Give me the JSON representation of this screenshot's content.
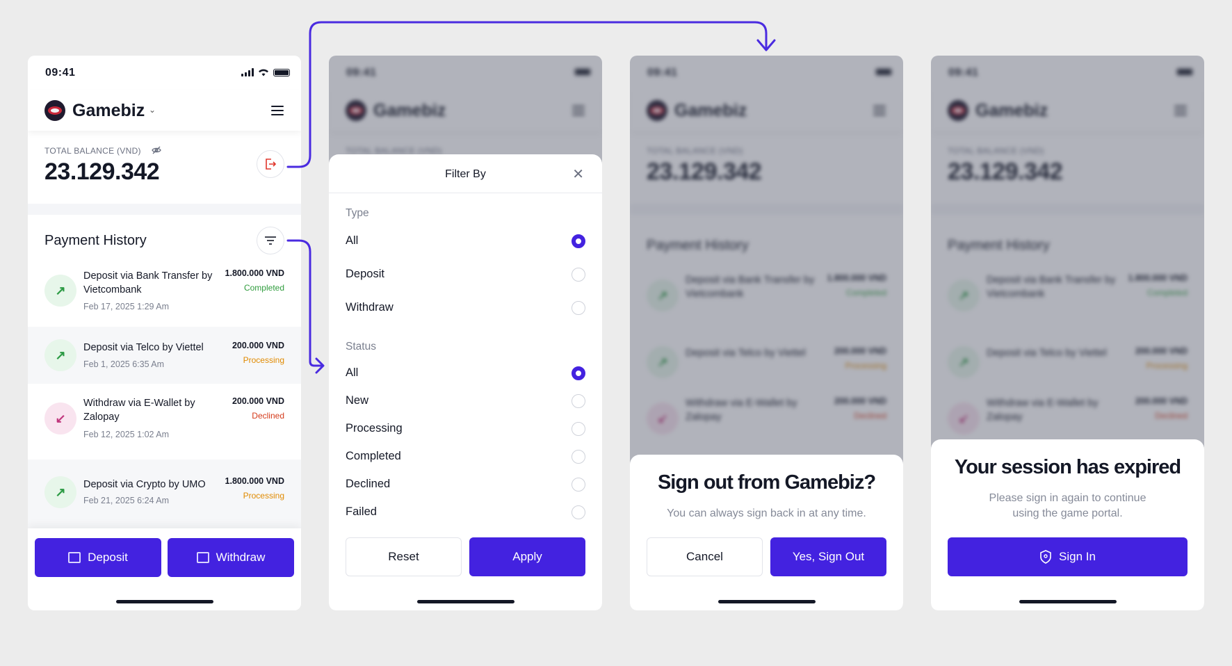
{
  "status_bar": {
    "time": "09:41"
  },
  "app": {
    "brand": "Gamebiz"
  },
  "balance": {
    "label": "TOTAL BALANCE (VND)",
    "value": "23.129.342"
  },
  "history": {
    "title": "Payment History",
    "transactions": [
      {
        "title": "Deposit via Bank Transfer by Vietcombank",
        "date": "Feb 17, 2025 1:29 Am",
        "amount": "1.800.000 VND",
        "status": "Completed",
        "direction": "in"
      },
      {
        "title": "Deposit via Telco by Viettel",
        "date": "Feb 1, 2025 6:35 Am",
        "amount": "200.000 VND",
        "status": "Processing",
        "direction": "in"
      },
      {
        "title": "Withdraw via E-Wallet by Zalopay",
        "date": "Feb 12, 2025 1:02 Am",
        "amount": "200.000 VND",
        "status": "Declined",
        "direction": "out"
      },
      {
        "title": "Deposit via Crypto by UMO",
        "date": "Feb 21, 2025 6:24 Am",
        "amount": "1.800.000 VND",
        "status": "Processing",
        "direction": "in"
      }
    ]
  },
  "actions": {
    "deposit": "Deposit",
    "withdraw": "Withdraw"
  },
  "filter_sheet": {
    "title": "Filter By",
    "type_label": "Type",
    "type_options": [
      "All",
      "Deposit",
      "Withdraw"
    ],
    "type_selected": "All",
    "status_label": "Status",
    "status_options": [
      "All",
      "New",
      "Processing",
      "Completed",
      "Declined",
      "Failed"
    ],
    "status_selected": "All",
    "reset_label": "Reset",
    "apply_label": "Apply"
  },
  "signout_dialog": {
    "title": "Sign out from Gamebiz?",
    "message": "You can always sign back in at any time.",
    "cancel_label": "Cancel",
    "confirm_label": "Yes, Sign Out"
  },
  "session_dialog": {
    "title": "Your session has expired",
    "message": "Please sign in again to continue using the game portal.",
    "signin_label": "Sign In"
  },
  "colors": {
    "primary": "#4322e0",
    "completed": "#2f9c3d",
    "processing": "#e08a00",
    "declined": "#d43a1a",
    "flow_arrow": "#4a2be0"
  },
  "icons": [
    "signal-icon",
    "wifi-icon",
    "battery-icon",
    "brand-logo",
    "chevron-down-icon",
    "menu-icon",
    "eye-off-icon",
    "logout-icon",
    "filter-icon",
    "arrow-up-right-icon",
    "arrow-down-left-icon",
    "deposit-icon",
    "withdraw-icon",
    "close-icon",
    "shield-icon"
  ]
}
